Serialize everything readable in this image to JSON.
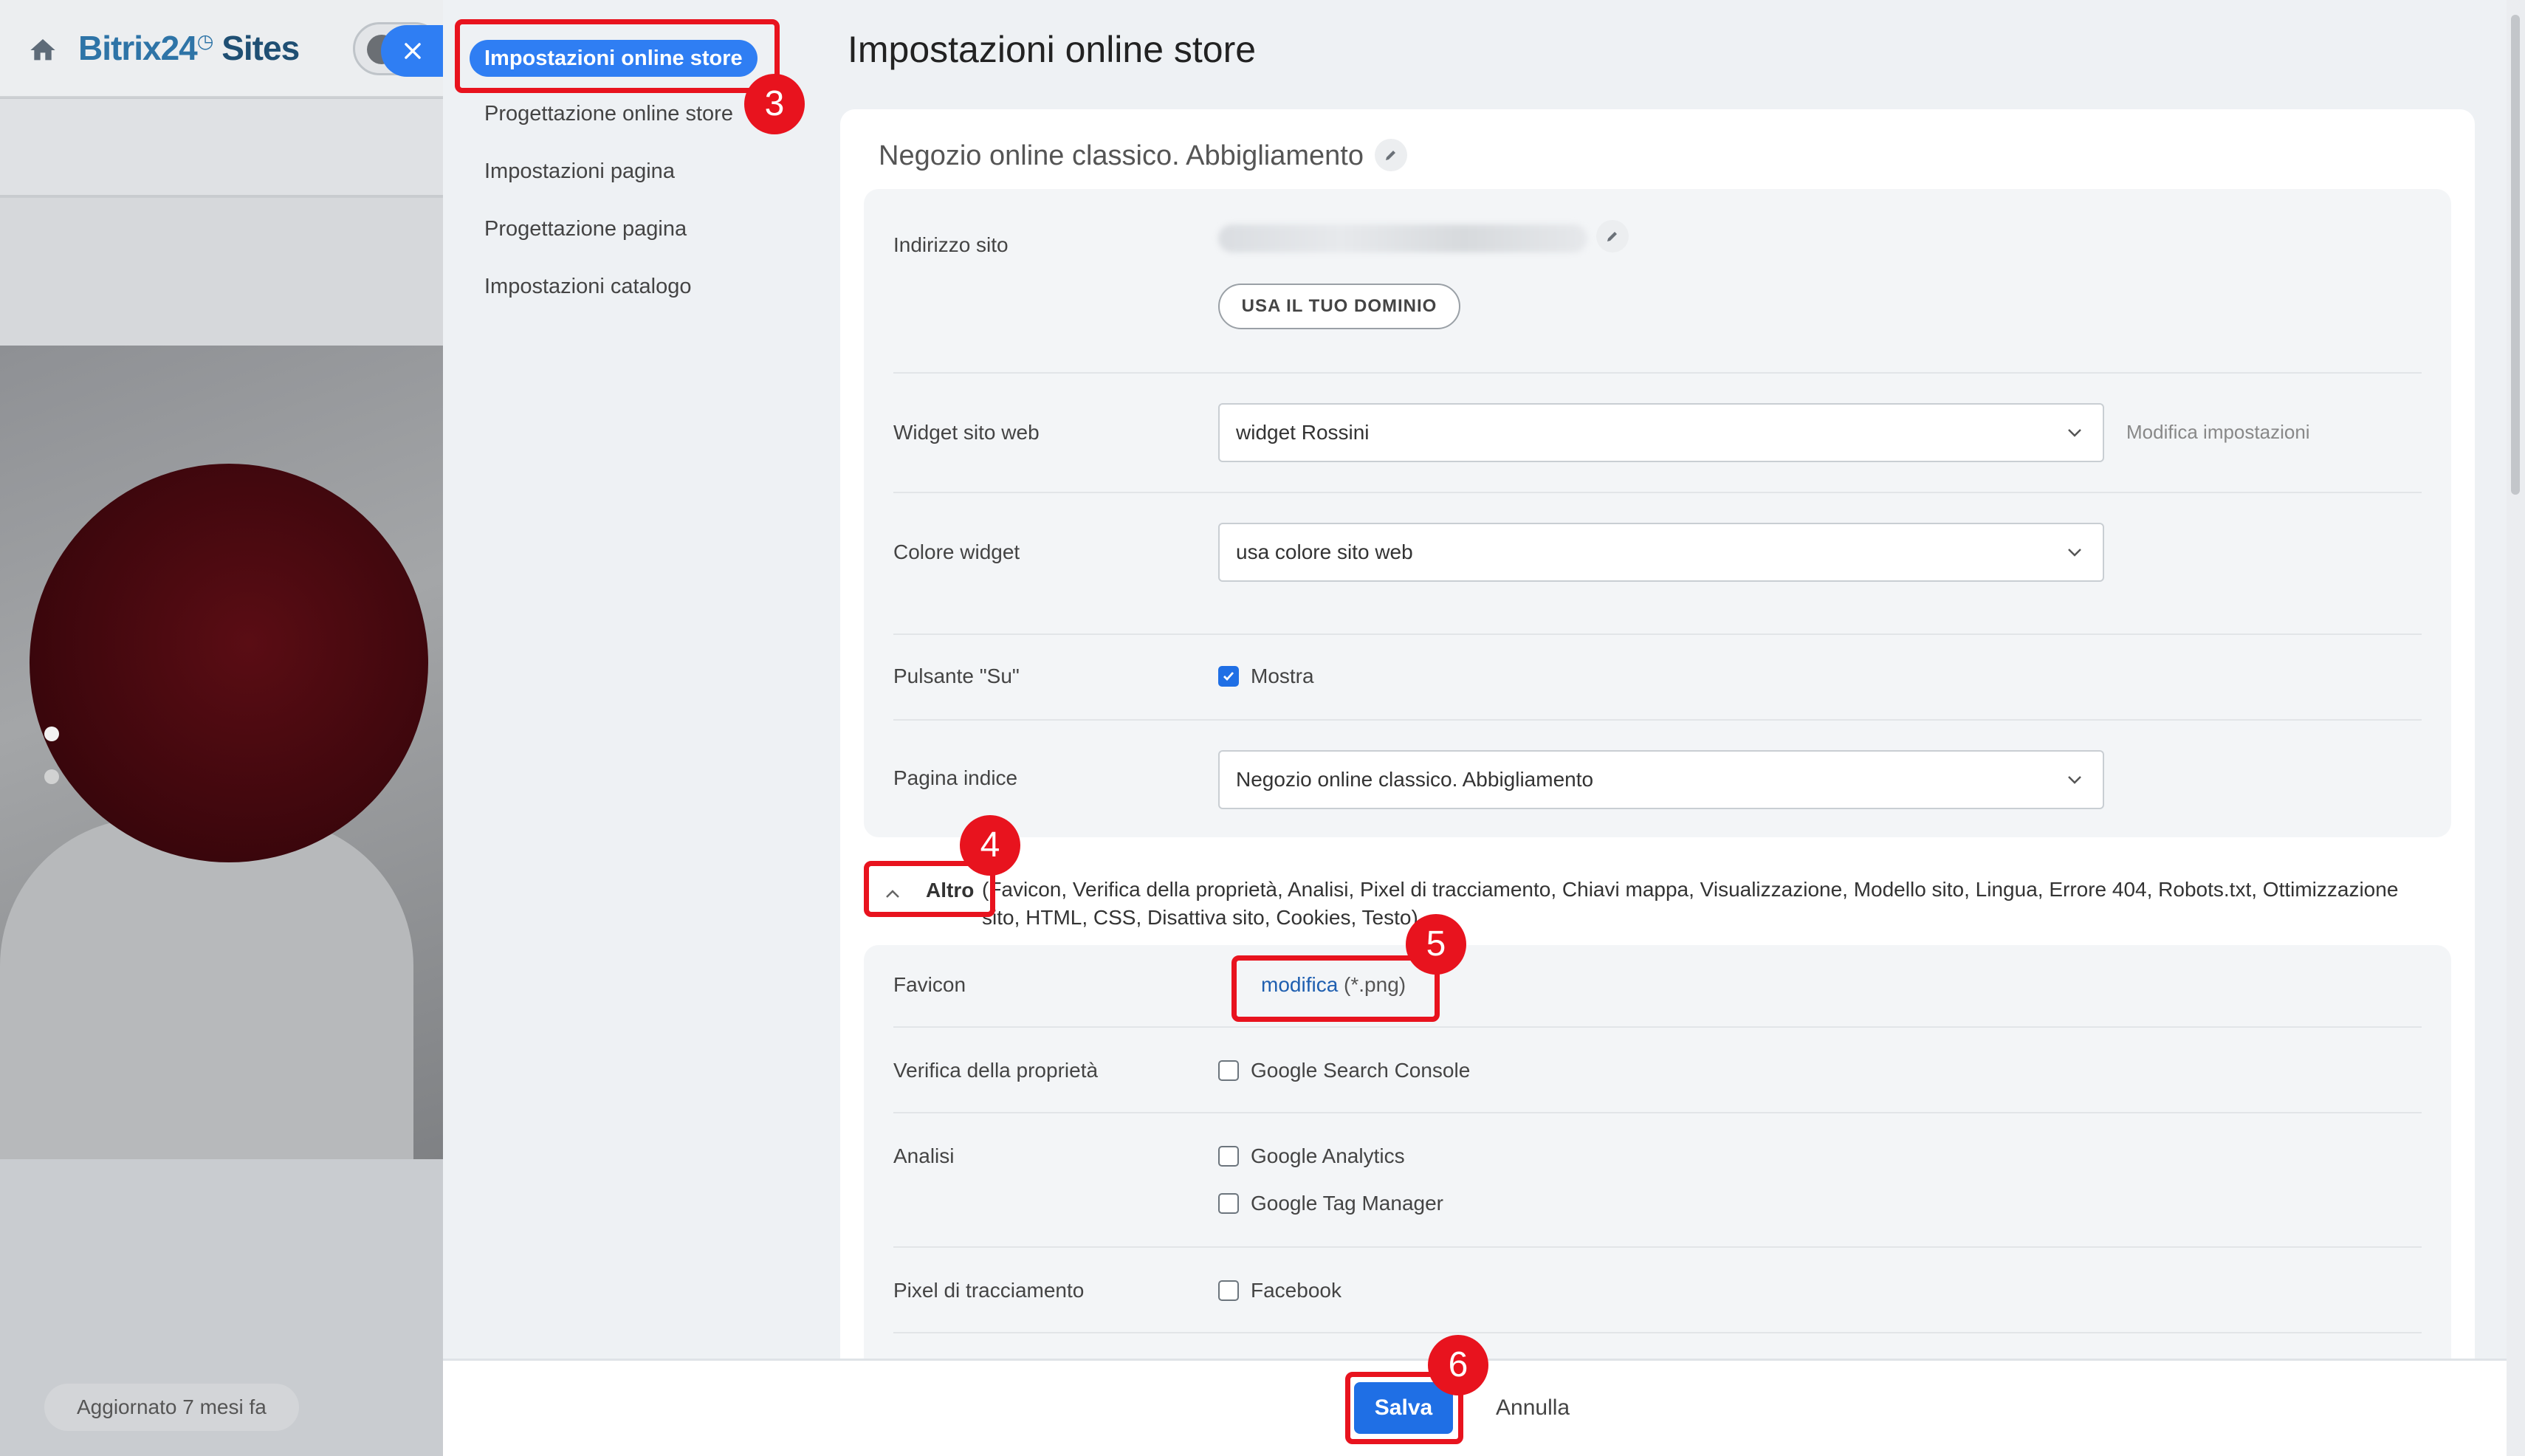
{
  "background": {
    "logo_brand": "Bitrix24",
    "logo_suffix": "Sites",
    "updated_label": "Aggiornato 7 mesi fa"
  },
  "nav": {
    "active": "Impostazioni online store",
    "items": [
      "Progettazione online store",
      "Impostazioni pagina",
      "Progettazione pagina",
      "Impostazioni catalogo"
    ]
  },
  "page": {
    "title": "Impostazioni online store",
    "site_name": "Negozio online classico. Abbigliamento"
  },
  "rows": {
    "address_label": "Indirizzo sito",
    "domain_button": "USA IL TUO DOMINIO",
    "widget_label": "Widget sito web",
    "widget_value": "widget Rossini",
    "widget_modify": "Modifica impostazioni",
    "color_label": "Colore widget",
    "color_value": "usa colore sito web",
    "up_label": "Pulsante \"Su\"",
    "up_checkbox": "Mostra",
    "index_label": "Pagina indice",
    "index_value": "Negozio online classico. Abbigliamento"
  },
  "other": {
    "title": "Altro",
    "list": "(Favicon,  Verifica della proprietà,  Analisi,  Pixel di tracciamento,  Chiavi mappa,  Visualizzazione,  Modello sito,  Lingua,  Errore 404,  Robots.txt,  Ottimizzazione sito,  HTML,  CSS,  Disattiva sito,  Cookies,  Testo)",
    "favicon_label": "Favicon",
    "favicon_link": "modifica",
    "favicon_ext": "(*.png)",
    "ownership_label": "Verifica della proprietà",
    "ownership_option": "Google Search Console",
    "analytics_label": "Analisi",
    "analytics_option1": "Google Analytics",
    "analytics_option2": "Google Tag Manager",
    "pixel_label": "Pixel di tracciamento",
    "pixel_option": "Facebook"
  },
  "footer": {
    "save": "Salva",
    "cancel": "Annulla"
  },
  "annotations": {
    "step3": "3",
    "step4": "4",
    "step5": "5",
    "step6": "6"
  },
  "colors": {
    "accent": "#2f7ef3",
    "highlight": "#e8131e"
  }
}
